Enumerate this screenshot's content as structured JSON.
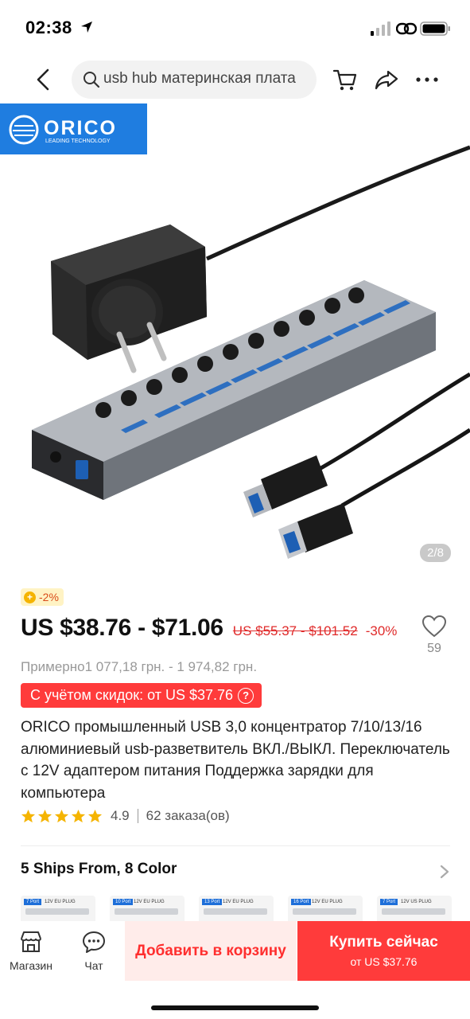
{
  "status_bar": {
    "time": "02:38"
  },
  "header": {
    "search_text": "usb hub материнская плата"
  },
  "gallery": {
    "logo_text": "ORICO",
    "logo_tagline": "LEADING TECHNOLOGY",
    "page_counter": "2/8"
  },
  "price": {
    "coin_discount": "-2%",
    "current_range": "US $38.76 - $71.06",
    "old_range": "US $55.37 - $101.52",
    "discount_percent": "-30%",
    "approx_local": "Примерно1 077,18 грн. - 1 974,82 грн.",
    "discount_banner": "С учётом скидок: от US $37.76"
  },
  "wishlist": {
    "count": "59"
  },
  "product": {
    "title": "ORICO промышленный USB 3,0 концентратор 7/10/13/16 алюминиевый usb-разветвитель ВКЛ./ВЫКЛ. Переключатель с 12V адаптером питания Поддержка зарядки для компьютера",
    "rating": "4.9",
    "orders": "62 заказа(ов)",
    "stars": 5
  },
  "shipping": {
    "label": "5 Ships From, 8 Color"
  },
  "variants": [
    {
      "tag": "7 Port",
      "plug": "12V EU PLUG"
    },
    {
      "tag": "10 Port",
      "plug": "12V EU PLUG"
    },
    {
      "tag": "13 Port",
      "plug": "12V EU PLUG"
    },
    {
      "tag": "16 Port",
      "plug": "12V EU PLUG"
    },
    {
      "tag": "7 Port",
      "plug": "12V US PLUG"
    }
  ],
  "bottom_bar": {
    "store_label": "Магазин",
    "chat_label": "Чат",
    "add_to_cart": "Добавить в корзину",
    "buy_now": "Купить сейчас",
    "buy_now_price": "от US $37.76"
  },
  "colors": {
    "accent_red": "#ff3b3b",
    "logo_blue": "#1f7de0",
    "star_yellow": "#f5b400"
  }
}
